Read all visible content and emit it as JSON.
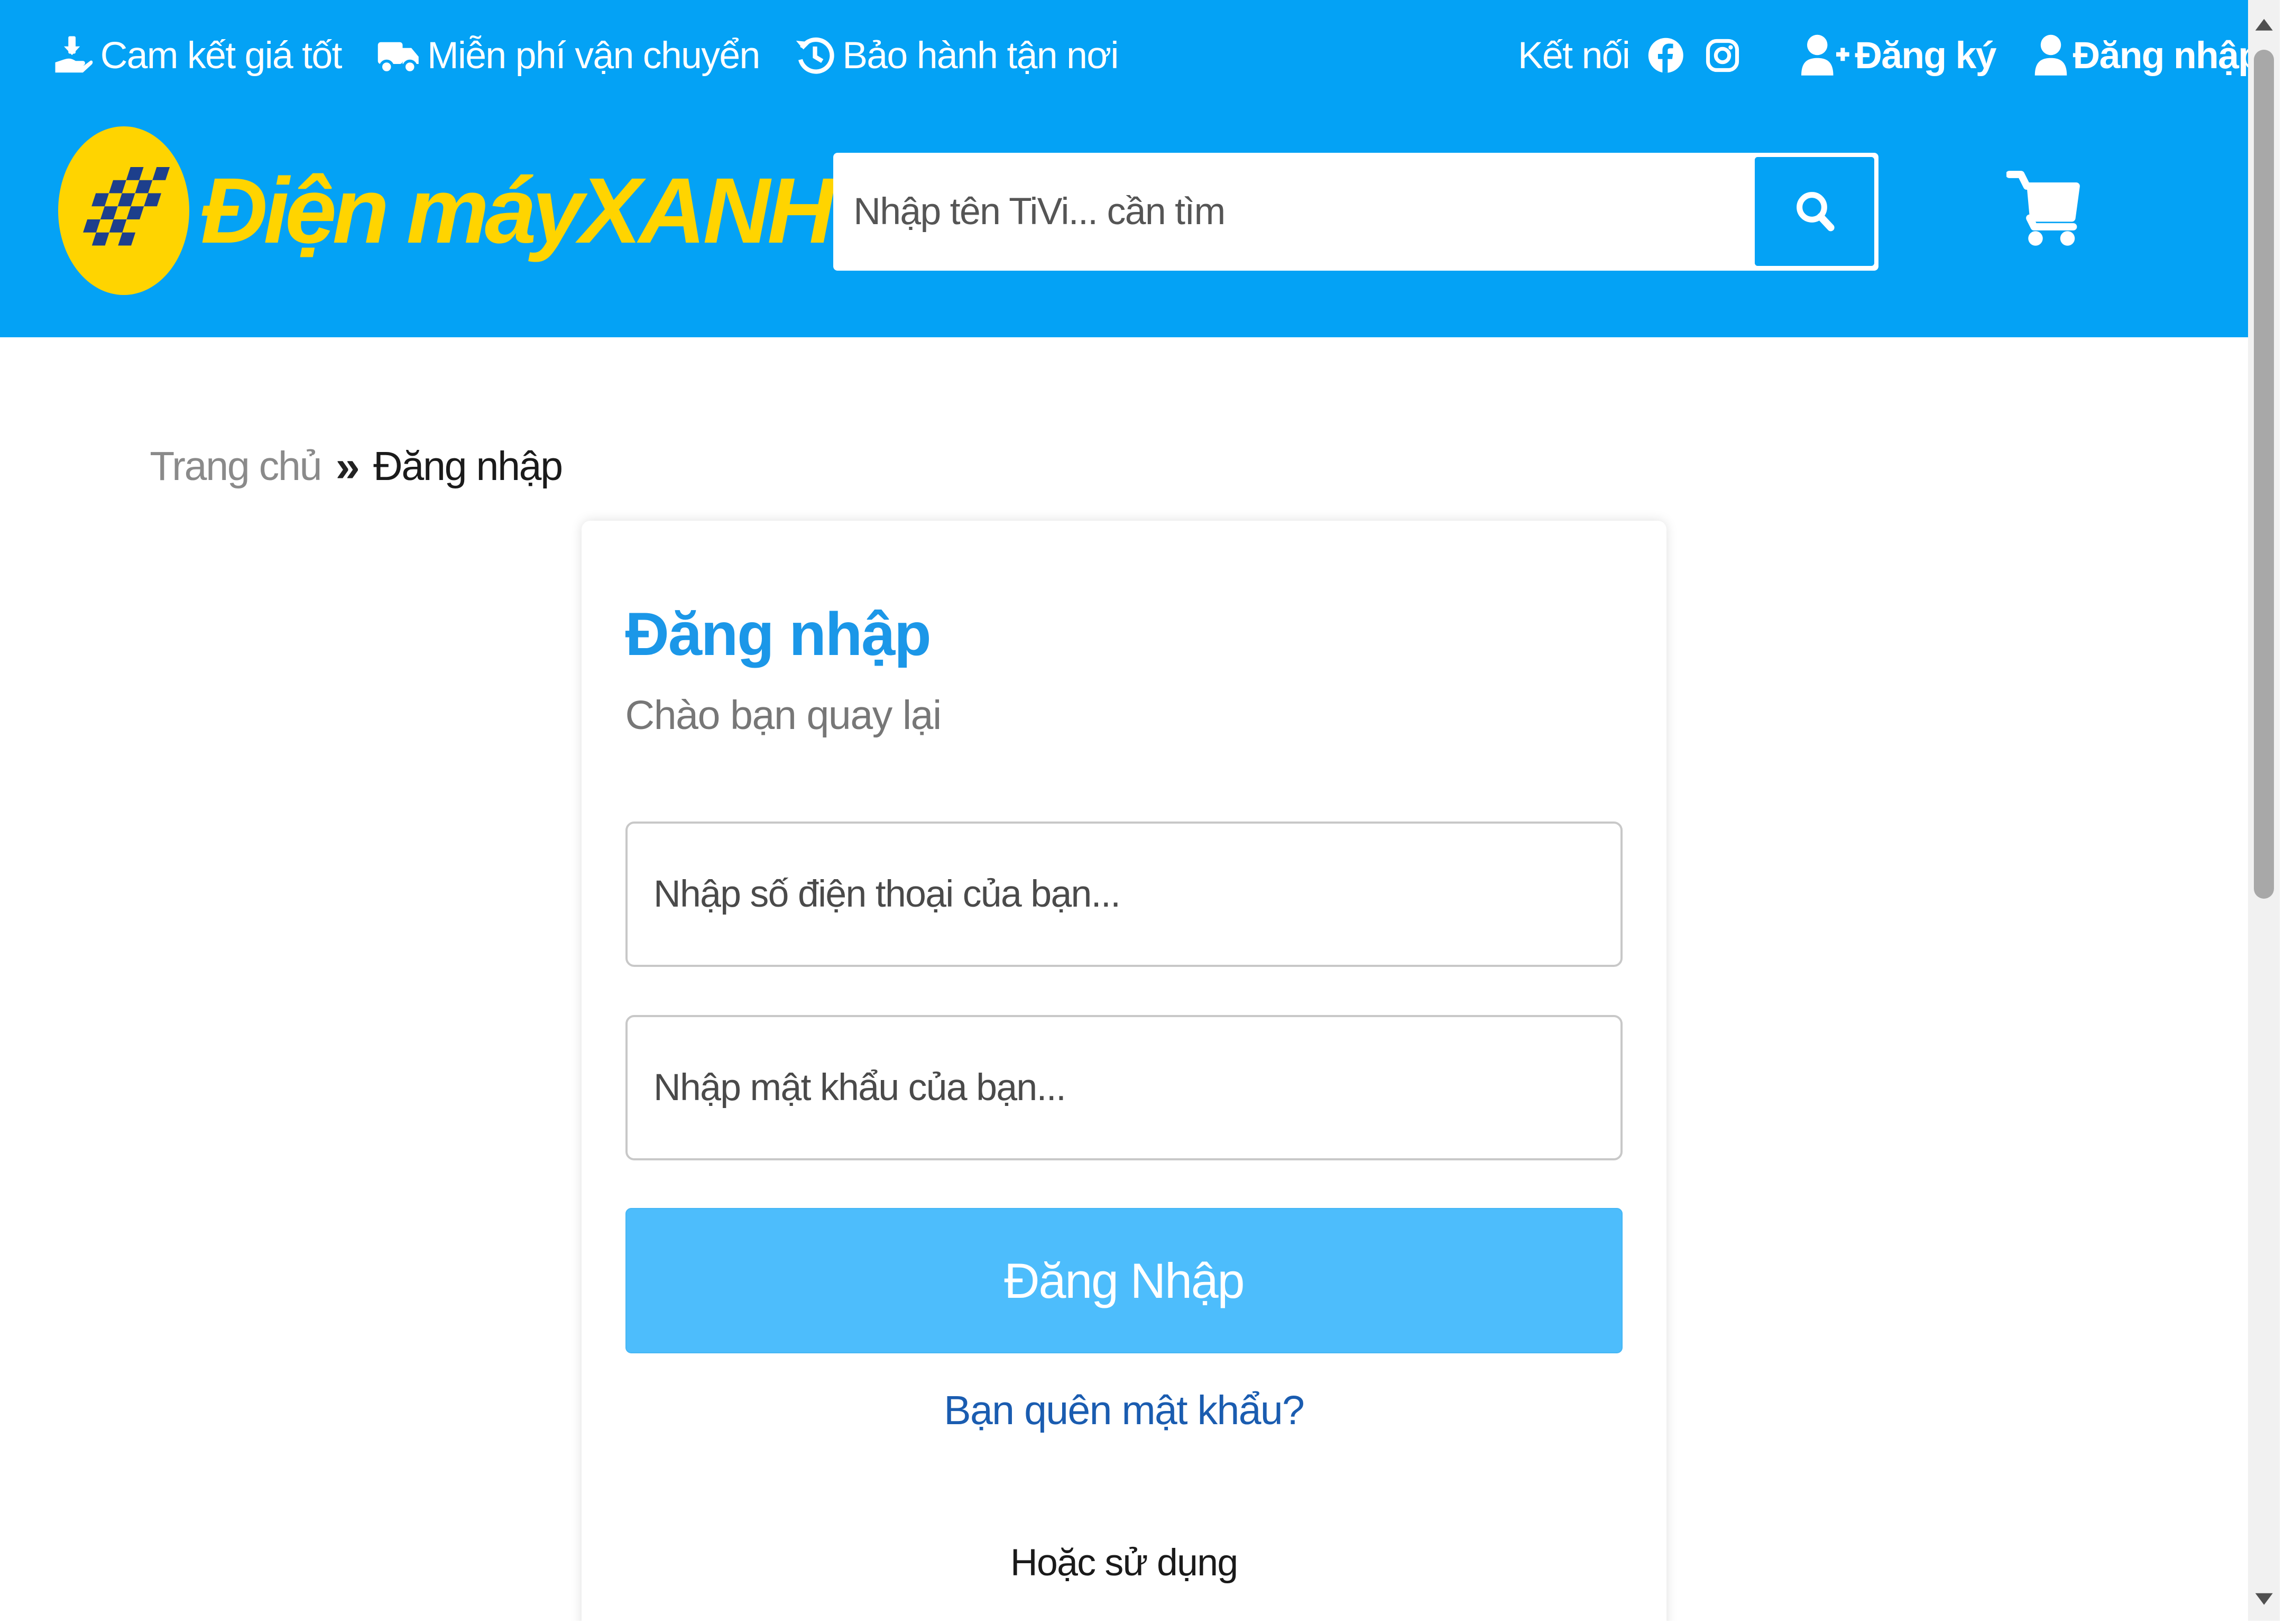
{
  "topbar": {
    "best_price": "Cam kết giá tốt",
    "free_shipping": "Miễn phí vận chuyển",
    "warranty": "Bảo hành tận nơi",
    "connect": "Kết nối",
    "register": "Đăng ký",
    "login": "Đăng nhập"
  },
  "logo": {
    "text_regular": "Điện máy",
    "text_strong": "XANH"
  },
  "search": {
    "placeholder": "Nhập tên TiVi... cần tìm",
    "button_icon": "search-icon"
  },
  "cart": {
    "icon": "cart-icon"
  },
  "breadcrumb": {
    "home": "Trang chủ",
    "separator": "»",
    "current": "Đăng nhập"
  },
  "login_card": {
    "title": "Đăng nhập",
    "subtitle": "Chào bạn quay lại",
    "phone_placeholder": "Nhập số điện thoại của bạn...",
    "password_placeholder": "Nhập mật khẩu của bạn...",
    "submit_label": "Đăng Nhập",
    "forgot_password": "Bạn quên mật khẩu?",
    "alternative": "Hoặc sử dụng"
  },
  "colors": {
    "header_bg": "#04a2f5",
    "brand_yellow": "#ffd400",
    "title_blue": "#1b97e8",
    "button_blue": "#4dbdfc",
    "link_blue": "#1a5cb0"
  }
}
